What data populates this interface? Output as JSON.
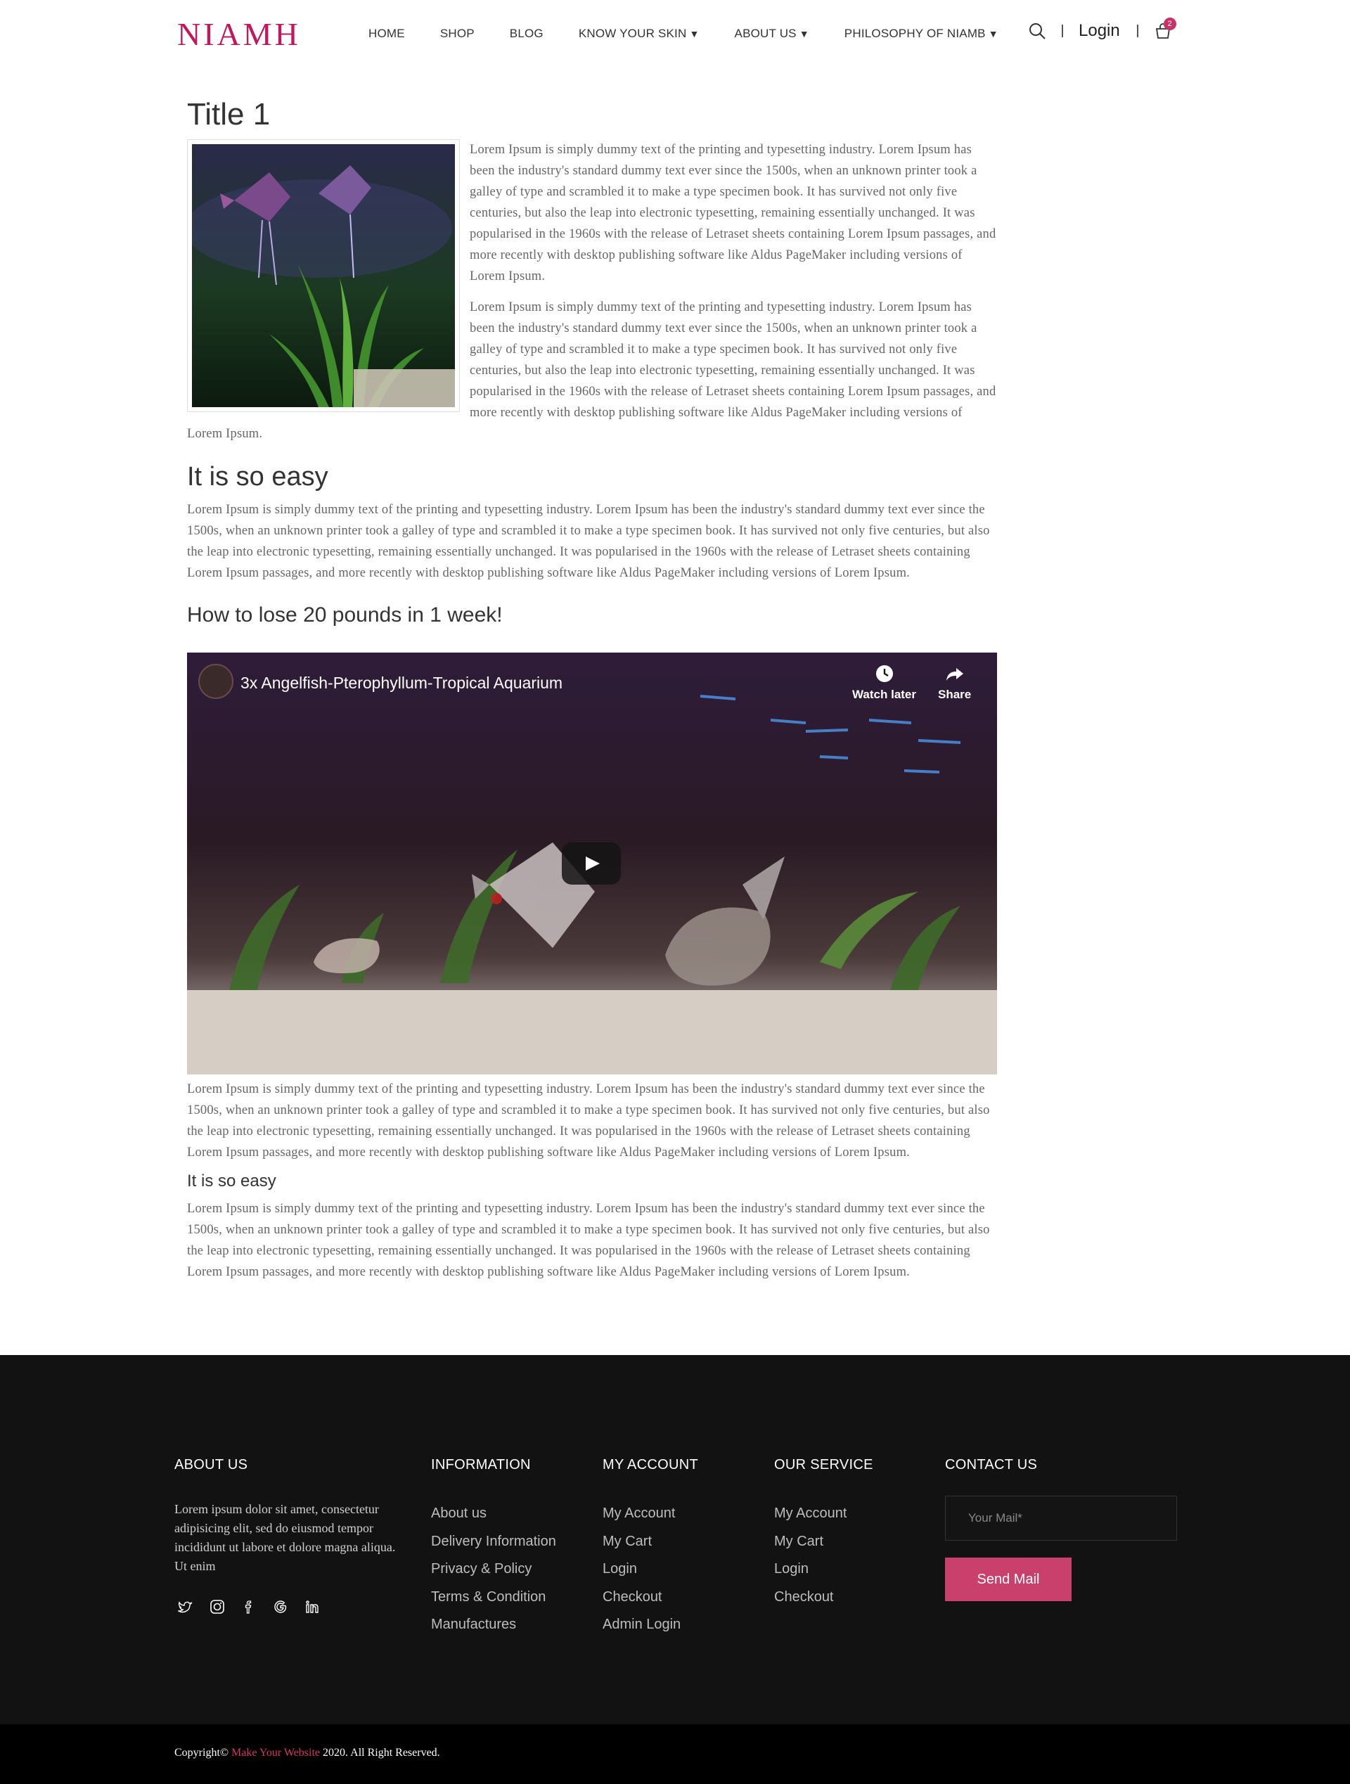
{
  "header": {
    "logo": "NIAMH",
    "nav": [
      {
        "label": "HOME",
        "has_dropdown": false
      },
      {
        "label": "SHOP",
        "has_dropdown": false
      },
      {
        "label": "BLOG",
        "has_dropdown": false
      },
      {
        "label": "KNOW YOUR SKIN",
        "has_dropdown": true
      },
      {
        "label": "ABOUT US",
        "has_dropdown": true
      },
      {
        "label": "PHILOSOPHY OF NIAMB",
        "has_dropdown": true
      }
    ],
    "caret": "▼",
    "login_label": "Login",
    "cart_count": "2"
  },
  "article": {
    "title": "Title 1",
    "para1": "Lorem Ipsum is simply dummy text of the printing and typesetting industry. Lorem Ipsum has been the industry's standard dummy text ever since the 1500s, when an unknown printer took a galley of type and scrambled it to make a type specimen book. It has survived not only five centuries, but also the leap into electronic typesetting, remaining essentially unchanged. It was popularised in the 1960s with the release of Letraset sheets containing Lorem Ipsum passages, and more recently with desktop publishing software like Aldus PageMaker including versions of Lorem Ipsum.",
    "para2": "Lorem Ipsum is simply dummy text of the printing and typesetting industry. Lorem Ipsum has been the industry's standard dummy text ever since the 1500s, when an unknown printer took a galley of type and scrambled it to make a type specimen book. It has survived not only five centuries, but also the leap into electronic typesetting, remaining essentially unchanged. It was popularised in the 1960s with the release of Letraset sheets containing Lorem Ipsum passages, and more recently with desktop publishing software like Aldus PageMaker including versions of Lorem Ipsum.",
    "heading2": "It is so easy",
    "para3": "Lorem Ipsum is simply dummy text of the printing and typesetting industry. Lorem Ipsum has been the industry's standard dummy text ever since the 1500s, when an unknown printer took a galley of type and scrambled it to make a type specimen book. It has survived not only five centuries, but also the leap into electronic typesetting, remaining essentially unchanged. It was popularised in the 1960s with the release of Letraset sheets containing Lorem Ipsum passages, and more recently with desktop publishing software like Aldus PageMaker including versions of Lorem Ipsum.",
    "heading3": "How to lose 20 pounds in 1 week!",
    "video": {
      "title": "3x Angelfish-Pterophyllum-Tropical Aquarium",
      "watch_later": "Watch later",
      "share": "Share"
    },
    "para4": "Lorem Ipsum is simply dummy text of the printing and typesetting industry. Lorem Ipsum has been the industry's standard dummy text ever since the 1500s, when an unknown printer took a galley of type and scrambled it to make a type specimen book. It has survived not only five centuries, but also the leap into electronic typesetting, remaining essentially unchanged. It was popularised in the 1960s with the release of Letraset sheets containing Lorem Ipsum passages, and more recently with desktop publishing software like Aldus PageMaker including versions of Lorem Ipsum.",
    "heading4": "It is so easy",
    "para5": "Lorem Ipsum is simply dummy text of the printing and typesetting industry. Lorem Ipsum has been the industry's standard dummy text ever since the 1500s, when an unknown printer took a galley of type and scrambled it to make a type specimen book. It has survived not only five centuries, but also the leap into electronic typesetting, remaining essentially unchanged. It was popularised in the 1960s with the release of Letraset sheets containing Lorem Ipsum passages, and more recently with desktop publishing software like Aldus PageMaker including versions of Lorem Ipsum."
  },
  "footer": {
    "about": {
      "heading": "ABOUT US",
      "text": "Lorem ipsum dolor sit amet, consectetur adipisicing elit, sed do eiusmod tempor incididunt ut labore et dolore magna aliqua. Ut enim"
    },
    "social_icons": [
      "twitter-icon",
      "instagram-icon",
      "facebook-icon",
      "google-icon",
      "linkedin-icon"
    ],
    "information": {
      "heading": "INFORMATION",
      "links": [
        "About us",
        "Delivery Information",
        "Privacy & Policy",
        "Terms & Condition",
        "Manufactures"
      ]
    },
    "my_account": {
      "heading": "MY ACCOUNT",
      "links": [
        "My Account",
        "My Cart",
        "Login",
        "Checkout",
        "Admin Login"
      ]
    },
    "our_service": {
      "heading": "OUR SERVICE",
      "links": [
        "My Account",
        "My Cart",
        "Login",
        "Checkout"
      ]
    },
    "contact": {
      "heading": "CONTACT US",
      "mail_placeholder": "Your Mail*",
      "send_label": "Send Mail"
    }
  },
  "copyright": {
    "prefix": "Copyright© ",
    "brand": "Make Your Website",
    "suffix": " 2020. All Right Reserved."
  },
  "colors": {
    "accent": "#c9406d",
    "footer_bg": "#121212",
    "copyright_bg": "#000000"
  }
}
